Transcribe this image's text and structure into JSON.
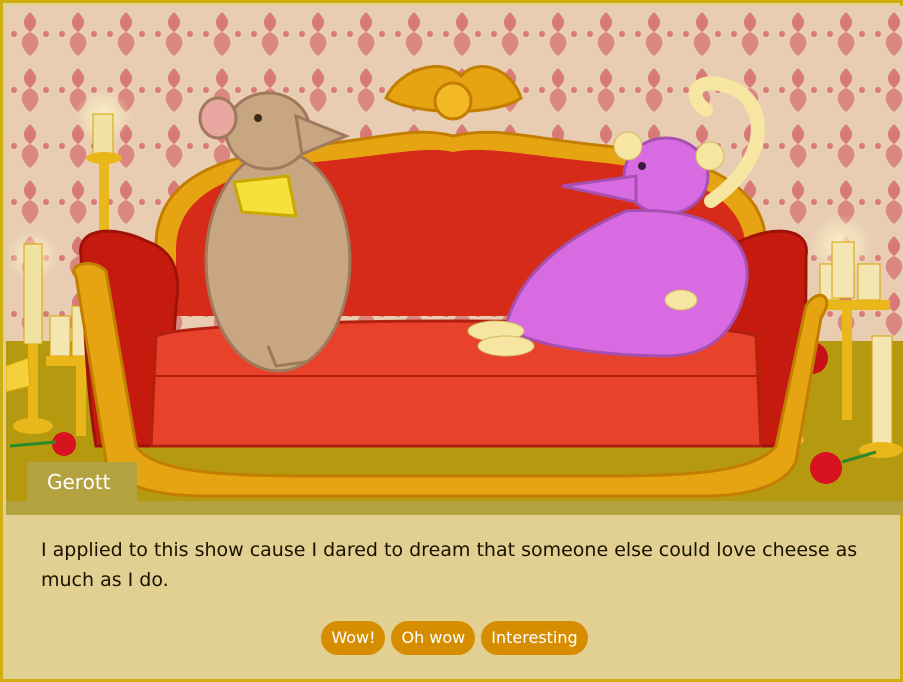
{
  "speaker": {
    "name": "Gerott"
  },
  "dialog": {
    "text": "I applied to this show cause I dared to dream that someone else could love cheese as much as I do."
  },
  "choices": [
    {
      "label": "Wow!"
    },
    {
      "label": "Oh wow"
    },
    {
      "label": "Interesting"
    }
  ],
  "colors": {
    "wallpaper": "#e8cdb2",
    "wallpaper_pattern": "#d97a78",
    "floor": "#b59a10",
    "sofa": "#e23a1e",
    "sofa_frame": "#e7a412",
    "dialog_bg": "#e2d092",
    "nameplate": "#b3a23f",
    "button": "#d68e00"
  }
}
